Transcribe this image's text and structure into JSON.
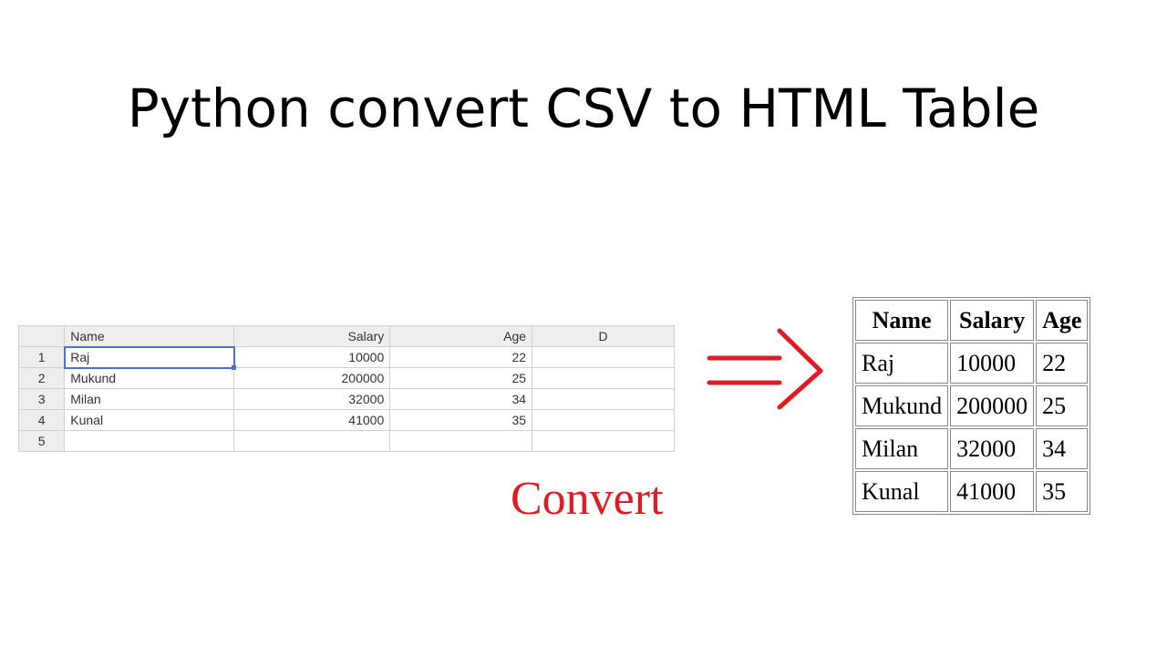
{
  "title": "Python convert CSV to HTML Table",
  "convert_label": "Convert",
  "spreadsheet": {
    "columns": [
      "Name",
      "Salary",
      "Age",
      "D"
    ],
    "row_numbers": [
      "1",
      "2",
      "3",
      "4",
      "5"
    ],
    "rows": [
      {
        "name": "Raj",
        "salary": "10000",
        "age": "22",
        "d": ""
      },
      {
        "name": "Mukund",
        "salary": "200000",
        "age": "25",
        "d": ""
      },
      {
        "name": "Milan",
        "salary": "32000",
        "age": "34",
        "d": ""
      },
      {
        "name": "Kunal",
        "salary": "41000",
        "age": "35",
        "d": ""
      },
      {
        "name": "",
        "salary": "",
        "age": "",
        "d": ""
      }
    ]
  },
  "html_table": {
    "headers": [
      "Name",
      "Salary",
      "Age"
    ],
    "rows": [
      {
        "name": "Raj",
        "salary": "10000",
        "age": "22"
      },
      {
        "name": "Mukund",
        "salary": "200000",
        "age": "25"
      },
      {
        "name": "Milan",
        "salary": "32000",
        "age": "34"
      },
      {
        "name": "Kunal",
        "salary": "41000",
        "age": "35"
      }
    ]
  },
  "chart_data": {
    "type": "table",
    "title": "Python convert CSV to HTML Table",
    "columns": [
      "Name",
      "Salary",
      "Age"
    ],
    "rows": [
      [
        "Raj",
        10000,
        22
      ],
      [
        "Mukund",
        200000,
        25
      ],
      [
        "Milan",
        32000,
        34
      ],
      [
        "Kunal",
        41000,
        35
      ]
    ]
  }
}
